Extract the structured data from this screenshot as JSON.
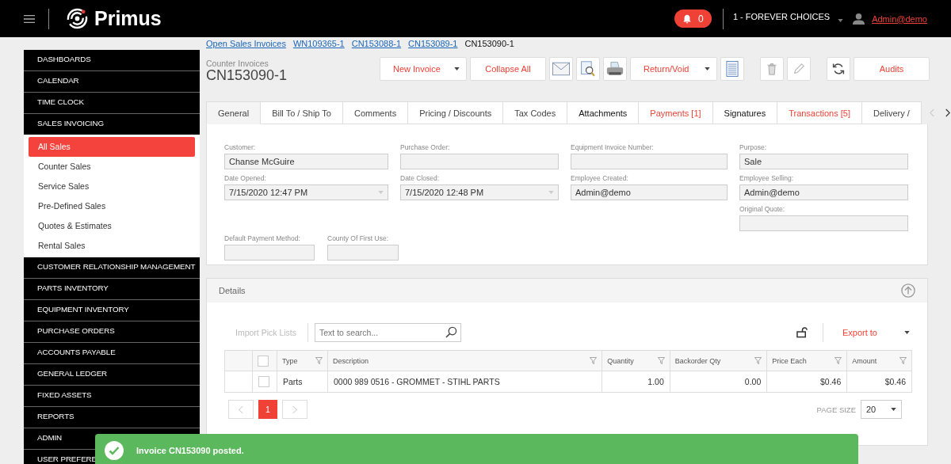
{
  "topbar": {
    "brand": "Primus",
    "notifications": "0",
    "company": "1 - FOREVER CHOICES",
    "user": "Admin@demo"
  },
  "breadcrumbs": [
    {
      "label": "Open Sales Invoices",
      "link": true
    },
    {
      "label": "WN109365-1",
      "link": true
    },
    {
      "label": "CN153088-1",
      "link": true
    },
    {
      "label": "CN153089-1",
      "link": true
    },
    {
      "label": "CN153090-1",
      "link": false
    }
  ],
  "sidebar": {
    "items": [
      {
        "label": "DASHBOARDS",
        "expanded": false
      },
      {
        "label": "CALENDAR",
        "expanded": false
      },
      {
        "label": "TIME CLOCK",
        "expanded": false
      },
      {
        "label": "SALES INVOICING",
        "expanded": true,
        "children": [
          {
            "label": "All Sales",
            "selected": true
          },
          {
            "label": "Counter Sales",
            "selected": false
          },
          {
            "label": "Service Sales",
            "selected": false
          },
          {
            "label": "Pre-Defined Sales",
            "selected": false
          },
          {
            "label": "Quotes & Estimates",
            "selected": false
          },
          {
            "label": "Rental Sales",
            "selected": false
          }
        ]
      },
      {
        "label": "CUSTOMER RELATIONSHIP MANAGEMENT",
        "expanded": false
      },
      {
        "label": "PARTS INVENTORY",
        "expanded": false
      },
      {
        "label": "EQUIPMENT INVENTORY",
        "expanded": false
      },
      {
        "label": "PURCHASE ORDERS",
        "expanded": false
      },
      {
        "label": "ACCOUNTS PAYABLE",
        "expanded": false
      },
      {
        "label": "GENERAL LEDGER",
        "expanded": false
      },
      {
        "label": "FIXED ASSETS",
        "expanded": false
      },
      {
        "label": "REPORTS",
        "expanded": false
      },
      {
        "label": "ADMIN",
        "expanded": false
      },
      {
        "label": "USER PREFERE",
        "expanded": false
      }
    ]
  },
  "header": {
    "subtitle": "Counter Invoices",
    "title": "CN153090-1"
  },
  "toolbar": [
    {
      "kind": "dropdown",
      "label": "New Invoice"
    },
    {
      "kind": "text",
      "label": "Collapse All"
    },
    {
      "kind": "mail"
    },
    {
      "kind": "preview"
    },
    {
      "kind": "print"
    },
    {
      "kind": "dropdown",
      "label": "Return/Void"
    },
    {
      "kind": "report"
    },
    {
      "kind": "delete"
    },
    {
      "kind": "edit",
      "disabled": true
    },
    {
      "kind": "refresh"
    },
    {
      "kind": "text",
      "label": "Audits"
    }
  ],
  "tabs": [
    {
      "label": "General",
      "selected": true,
      "kind": "normal"
    },
    {
      "label": "Bill To / Ship To",
      "selected": false,
      "kind": "normal"
    },
    {
      "label": "Comments",
      "selected": false,
      "kind": "normal"
    },
    {
      "label": "Pricing / Discounts",
      "selected": false,
      "kind": "normal"
    },
    {
      "label": "Tax Codes",
      "selected": false,
      "kind": "normal"
    },
    {
      "label": "Attachments",
      "selected": false,
      "kind": "strong"
    },
    {
      "label": "Payments [1]",
      "selected": false,
      "kind": "alert"
    },
    {
      "label": "Signatures",
      "selected": false,
      "kind": "strong"
    },
    {
      "label": "Transactions [5]",
      "selected": false,
      "kind": "alert"
    },
    {
      "label": "Delivery /",
      "selected": false,
      "kind": "normal"
    }
  ],
  "form": {
    "main_fields": [
      {
        "label": "Customer:",
        "value": "Chanse McGuire",
        "kind": "text"
      },
      {
        "label": "Purchase Order:",
        "kind": "text"
      },
      {
        "label": "Equipment Invoice Number:",
        "kind": "text"
      },
      {
        "label": "Purpose:",
        "value": "Sale",
        "kind": "text"
      },
      {
        "label": "Date Opened:",
        "value": "7/15/2020 12:47 PM",
        "kind": "date"
      },
      {
        "label": "Date Closed:",
        "value": "7/15/2020 12:48 PM",
        "kind": "date"
      },
      {
        "label": "Employee Created:",
        "value": "Admin@demo",
        "kind": "text"
      },
      {
        "label": "Employee Selling:",
        "value": "Admin@demo",
        "kind": "text"
      }
    ],
    "side_fields": [
      {
        "label": "Original Quote:"
      }
    ],
    "payment_fields": [
      {
        "label": "Default Payment Method:"
      },
      {
        "label": "County Of First Use:"
      }
    ]
  },
  "details": {
    "title": "Details",
    "import_button": "Import Pick Lists",
    "search": {
      "placeholder": "Text to search..."
    },
    "export_button": "Export to",
    "table": {
      "all_checked": false,
      "columns": [
        "Type",
        "Description",
        "Quantity",
        "Backorder Qty",
        "Price Each",
        "Amount"
      ],
      "rows": [
        {
          "checked": false,
          "cells": [
            "Parts",
            "0000 989 0516 - GROMMET - STIHL PARTS",
            "1.00",
            "0.00",
            "$0.46",
            "$0.46"
          ]
        }
      ]
    },
    "pages": [
      {
        "label": "1",
        "selected": true
      }
    ],
    "page_size_label": "PAGE SIZE",
    "page_size": "20"
  },
  "toast": {
    "message": "Invoice CN153090 posted."
  }
}
